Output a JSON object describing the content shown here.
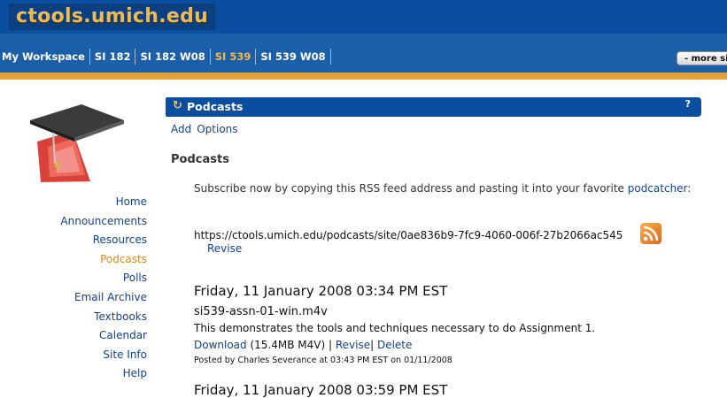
{
  "header": {
    "site_title": "ctools.umich.edu"
  },
  "tabs": [
    {
      "label": "My Workspace",
      "current": false
    },
    {
      "label": "SI 182",
      "current": false
    },
    {
      "label": "SI 182 W08",
      "current": false
    },
    {
      "label": "SI 539",
      "current": true
    },
    {
      "label": "SI 539 W08",
      "current": false
    }
  ],
  "more_sites_label": "- more sites",
  "nav": {
    "items": [
      "Home",
      "Announcements",
      "Resources",
      "Podcasts",
      "Polls",
      "Email Archive",
      "Textbooks",
      "Calendar",
      "Site Info",
      "Help"
    ],
    "current": "Podcasts"
  },
  "portlet": {
    "title": "Podcasts",
    "title_icon": "refresh-icon",
    "help": "?",
    "toolbar": {
      "add": "Add",
      "options": "Options"
    },
    "heading": "Podcasts",
    "subscribe_text": "Subscribe now by copying this RSS feed address and pasting it into your favorite",
    "subscribe_link": "podcatcher",
    "subscribe_suffix": ":",
    "feed_url": "https://ctools.umich.edu/podcasts/site/0ae836b9-7fc9-4060-006f-27b2066ac545",
    "feed_icon": "rss-feed-icon",
    "revise_label": "Revise"
  },
  "podcasts": [
    {
      "date": "Friday, 11 January 2008 03:34 PM EST",
      "file": "si539-assn-01-win.m4v",
      "description": "This demonstrates the tools and techniques necessary to do Assignment 1.",
      "download_label": "Download",
      "size_info": " (15.4MB M4V) | ",
      "revise_label": "Revise",
      "sep": "| ",
      "delete_label": "Delete",
      "posted": "Posted by Charles Severance at 03:43 PM EST on 01/11/2008"
    }
  ],
  "next_podcast_date": "Friday, 11 January 2008 03:59 PM EST",
  "colors": {
    "header_blue": "#0a4ea0",
    "tab_blue": "#1b5fa8",
    "accent_orange": "#e3a238",
    "link_blue": "#12418c",
    "current_orange": "#d48a23"
  }
}
